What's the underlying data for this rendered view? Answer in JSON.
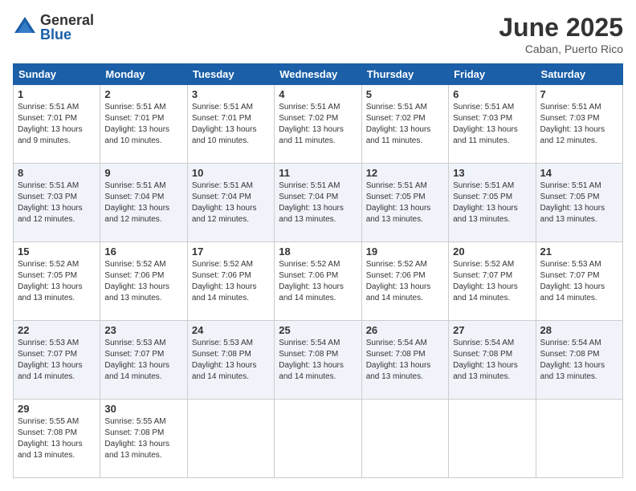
{
  "logo": {
    "general": "General",
    "blue": "Blue"
  },
  "title": "June 2025",
  "location": "Caban, Puerto Rico",
  "days_of_week": [
    "Sunday",
    "Monday",
    "Tuesday",
    "Wednesday",
    "Thursday",
    "Friday",
    "Saturday"
  ],
  "weeks": [
    [
      {
        "day": "1",
        "info": "Sunrise: 5:51 AM\nSunset: 7:01 PM\nDaylight: 13 hours\nand 9 minutes."
      },
      {
        "day": "2",
        "info": "Sunrise: 5:51 AM\nSunset: 7:01 PM\nDaylight: 13 hours\nand 10 minutes."
      },
      {
        "day": "3",
        "info": "Sunrise: 5:51 AM\nSunset: 7:01 PM\nDaylight: 13 hours\nand 10 minutes."
      },
      {
        "day": "4",
        "info": "Sunrise: 5:51 AM\nSunset: 7:02 PM\nDaylight: 13 hours\nand 11 minutes."
      },
      {
        "day": "5",
        "info": "Sunrise: 5:51 AM\nSunset: 7:02 PM\nDaylight: 13 hours\nand 11 minutes."
      },
      {
        "day": "6",
        "info": "Sunrise: 5:51 AM\nSunset: 7:03 PM\nDaylight: 13 hours\nand 11 minutes."
      },
      {
        "day": "7",
        "info": "Sunrise: 5:51 AM\nSunset: 7:03 PM\nDaylight: 13 hours\nand 12 minutes."
      }
    ],
    [
      {
        "day": "8",
        "info": "Sunrise: 5:51 AM\nSunset: 7:03 PM\nDaylight: 13 hours\nand 12 minutes."
      },
      {
        "day": "9",
        "info": "Sunrise: 5:51 AM\nSunset: 7:04 PM\nDaylight: 13 hours\nand 12 minutes."
      },
      {
        "day": "10",
        "info": "Sunrise: 5:51 AM\nSunset: 7:04 PM\nDaylight: 13 hours\nand 12 minutes."
      },
      {
        "day": "11",
        "info": "Sunrise: 5:51 AM\nSunset: 7:04 PM\nDaylight: 13 hours\nand 13 minutes."
      },
      {
        "day": "12",
        "info": "Sunrise: 5:51 AM\nSunset: 7:05 PM\nDaylight: 13 hours\nand 13 minutes."
      },
      {
        "day": "13",
        "info": "Sunrise: 5:51 AM\nSunset: 7:05 PM\nDaylight: 13 hours\nand 13 minutes."
      },
      {
        "day": "14",
        "info": "Sunrise: 5:51 AM\nSunset: 7:05 PM\nDaylight: 13 hours\nand 13 minutes."
      }
    ],
    [
      {
        "day": "15",
        "info": "Sunrise: 5:52 AM\nSunset: 7:05 PM\nDaylight: 13 hours\nand 13 minutes."
      },
      {
        "day": "16",
        "info": "Sunrise: 5:52 AM\nSunset: 7:06 PM\nDaylight: 13 hours\nand 13 minutes."
      },
      {
        "day": "17",
        "info": "Sunrise: 5:52 AM\nSunset: 7:06 PM\nDaylight: 13 hours\nand 14 minutes."
      },
      {
        "day": "18",
        "info": "Sunrise: 5:52 AM\nSunset: 7:06 PM\nDaylight: 13 hours\nand 14 minutes."
      },
      {
        "day": "19",
        "info": "Sunrise: 5:52 AM\nSunset: 7:06 PM\nDaylight: 13 hours\nand 14 minutes."
      },
      {
        "day": "20",
        "info": "Sunrise: 5:52 AM\nSunset: 7:07 PM\nDaylight: 13 hours\nand 14 minutes."
      },
      {
        "day": "21",
        "info": "Sunrise: 5:53 AM\nSunset: 7:07 PM\nDaylight: 13 hours\nand 14 minutes."
      }
    ],
    [
      {
        "day": "22",
        "info": "Sunrise: 5:53 AM\nSunset: 7:07 PM\nDaylight: 13 hours\nand 14 minutes."
      },
      {
        "day": "23",
        "info": "Sunrise: 5:53 AM\nSunset: 7:07 PM\nDaylight: 13 hours\nand 14 minutes."
      },
      {
        "day": "24",
        "info": "Sunrise: 5:53 AM\nSunset: 7:08 PM\nDaylight: 13 hours\nand 14 minutes."
      },
      {
        "day": "25",
        "info": "Sunrise: 5:54 AM\nSunset: 7:08 PM\nDaylight: 13 hours\nand 14 minutes."
      },
      {
        "day": "26",
        "info": "Sunrise: 5:54 AM\nSunset: 7:08 PM\nDaylight: 13 hours\nand 13 minutes."
      },
      {
        "day": "27",
        "info": "Sunrise: 5:54 AM\nSunset: 7:08 PM\nDaylight: 13 hours\nand 13 minutes."
      },
      {
        "day": "28",
        "info": "Sunrise: 5:54 AM\nSunset: 7:08 PM\nDaylight: 13 hours\nand 13 minutes."
      }
    ],
    [
      {
        "day": "29",
        "info": "Sunrise: 5:55 AM\nSunset: 7:08 PM\nDaylight: 13 hours\nand 13 minutes."
      },
      {
        "day": "30",
        "info": "Sunrise: 5:55 AM\nSunset: 7:08 PM\nDaylight: 13 hours\nand 13 minutes."
      },
      {
        "day": "",
        "info": ""
      },
      {
        "day": "",
        "info": ""
      },
      {
        "day": "",
        "info": ""
      },
      {
        "day": "",
        "info": ""
      },
      {
        "day": "",
        "info": ""
      }
    ]
  ]
}
